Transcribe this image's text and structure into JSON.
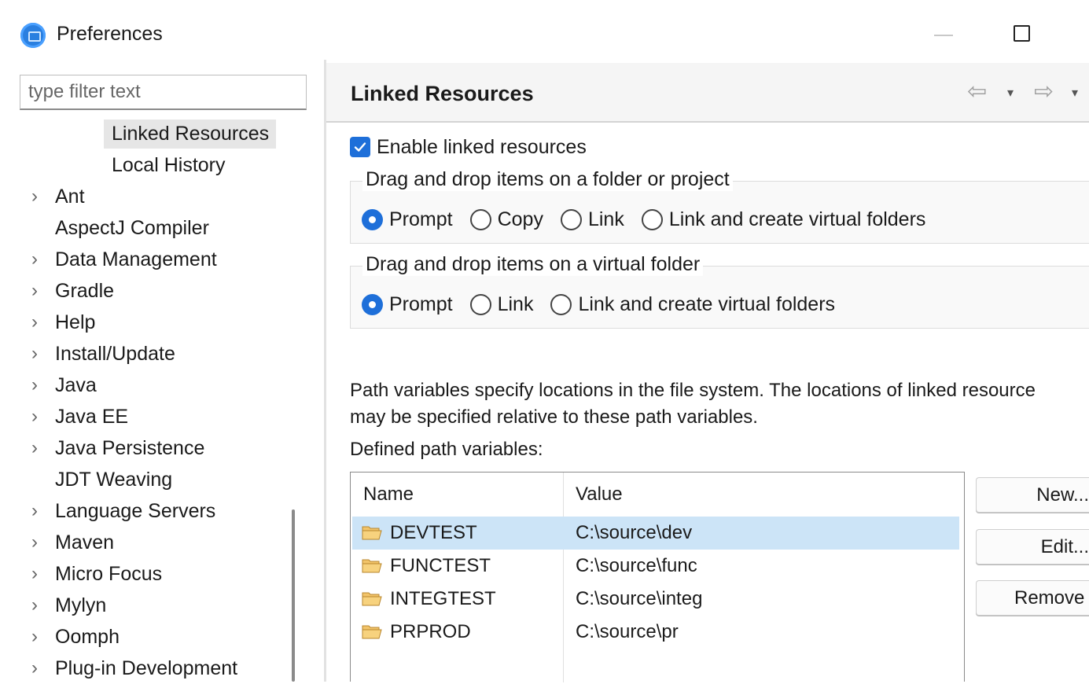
{
  "window": {
    "title": "Preferences"
  },
  "sidebar": {
    "filter_placeholder": "type filter text",
    "items": [
      {
        "label": "Linked Resources",
        "expandable": false,
        "child": true,
        "selected": true
      },
      {
        "label": "Local History",
        "expandable": false,
        "child": true,
        "selected": false
      },
      {
        "label": "Ant",
        "expandable": true
      },
      {
        "label": "AspectJ Compiler",
        "expandable": false
      },
      {
        "label": "Data Management",
        "expandable": true
      },
      {
        "label": "Gradle",
        "expandable": true
      },
      {
        "label": "Help",
        "expandable": true
      },
      {
        "label": "Install/Update",
        "expandable": true
      },
      {
        "label": "Java",
        "expandable": true
      },
      {
        "label": "Java EE",
        "expandable": true
      },
      {
        "label": "Java Persistence",
        "expandable": true
      },
      {
        "label": "JDT Weaving",
        "expandable": false
      },
      {
        "label": "Language Servers",
        "expandable": true
      },
      {
        "label": "Maven",
        "expandable": true
      },
      {
        "label": "Micro Focus",
        "expandable": true
      },
      {
        "label": "Mylyn",
        "expandable": true
      },
      {
        "label": "Oomph",
        "expandable": true
      },
      {
        "label": "Plug-in Development",
        "expandable": true
      }
    ],
    "chevron": "›"
  },
  "page": {
    "title": "Linked Resources",
    "nav_back": "⇦",
    "nav_forward": "⇨",
    "nav_dropdown": "▾",
    "enable_linked_label": "Enable linked resources",
    "enable_linked_checked": true,
    "group_folder": {
      "legend": "Drag and drop items on a folder or project",
      "options": [
        {
          "label": "Prompt",
          "selected": true
        },
        {
          "label": "Copy",
          "selected": false
        },
        {
          "label": "Link",
          "selected": false
        },
        {
          "label": "Link and create virtual folders",
          "selected": false
        }
      ]
    },
    "group_virtual": {
      "legend": "Drag and drop items on a virtual folder",
      "options": [
        {
          "label": "Prompt",
          "selected": true
        },
        {
          "label": "Link",
          "selected": false
        },
        {
          "label": "Link and create virtual folders",
          "selected": false
        }
      ]
    },
    "info_line1": "Path variables specify locations in the file system. The locations of linked resource",
    "info_line2": "may be specified relative to these path variables.",
    "defined_label": "Defined path variables:",
    "table": {
      "columns": [
        "Name",
        "Value"
      ],
      "rows": [
        {
          "name": "DEVTEST",
          "value": "C:\\source\\dev",
          "selected": true
        },
        {
          "name": "FUNCTEST",
          "value": "C:\\source\\func",
          "selected": false
        },
        {
          "name": "INTEGTEST",
          "value": "C:\\source\\integ",
          "selected": false
        },
        {
          "name": "PRPROD",
          "value": "C:\\source\\pr",
          "selected": false
        }
      ]
    },
    "buttons": {
      "new": "New...",
      "edit": "Edit...",
      "remove": "Remove"
    }
  },
  "colors": {
    "accent": "#1e6fd9",
    "selection": "#cce4f7",
    "tree_selection": "#e6e6e6",
    "folder": "#e8b04a"
  }
}
